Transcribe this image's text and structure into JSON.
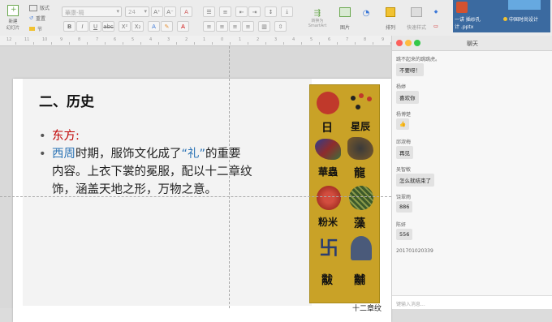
{
  "toolbar": {
    "new_slide_label": "新建\n幻灯片",
    "layout_label": "版式",
    "reset_label": "重置",
    "section_label": "节",
    "font_name": "華康-隔",
    "font_size": "24",
    "convert_smartart_label": "转换为\nSmartArt",
    "picture_label": "图片",
    "arrange_label": "排列",
    "quick_styles_label": "快速样式"
  },
  "desktop": {
    "file_label_1": "一讲 插纱孔\n计 .pptx",
    "file_label_2": "中国时尚设计"
  },
  "ruler": {
    "labels": [
      "12",
      "11",
      "10",
      "9",
      "8",
      "7",
      "6",
      "5",
      "4",
      "3",
      "2",
      "1",
      "0",
      "1",
      "2",
      "3",
      "4",
      "5",
      "6",
      "7",
      "8",
      "9"
    ]
  },
  "slide": {
    "title": "二、历史",
    "bullet1": "东方:",
    "bullet2_highlight": "西周",
    "bullet2_part1": "时期，服饰文化成了",
    "bullet2_quote": "“礼”",
    "bullet2_part2": "的重要",
    "bullet2_line2": "内容。上衣下裳的冕服，配以十二章纹",
    "bullet2_line3": "饰，涵盖天地之形，万物之意。",
    "image_caption": "十二章纹",
    "symbols": [
      "日",
      "星辰",
      "華蟲",
      "龍",
      "粉米",
      "藻",
      "黻",
      "黼"
    ],
    "colors": {
      "bullet1": "#c00000",
      "highlight": "#2e75b6",
      "body": "#222222",
      "panel": "#c9a227"
    }
  },
  "chat": {
    "title": "聊天",
    "messages": [
      {
        "name": "跳不起来的跳跳虎。",
        "text": "不要呀！"
      },
      {
        "name": "杨婷",
        "text": "喜欢你"
      },
      {
        "name": "杨博楚",
        "text": "👍"
      },
      {
        "name": "邱淑梅",
        "text": "再见"
      },
      {
        "name": "吴智敏",
        "text": "怎么就结束了"
      },
      {
        "name": "饶翠雨",
        "text": "886"
      },
      {
        "name": "陈妍",
        "text": "556"
      },
      {
        "name": "201701020339",
        "text": ""
      }
    ],
    "input_placeholder": "键输入消息..."
  }
}
